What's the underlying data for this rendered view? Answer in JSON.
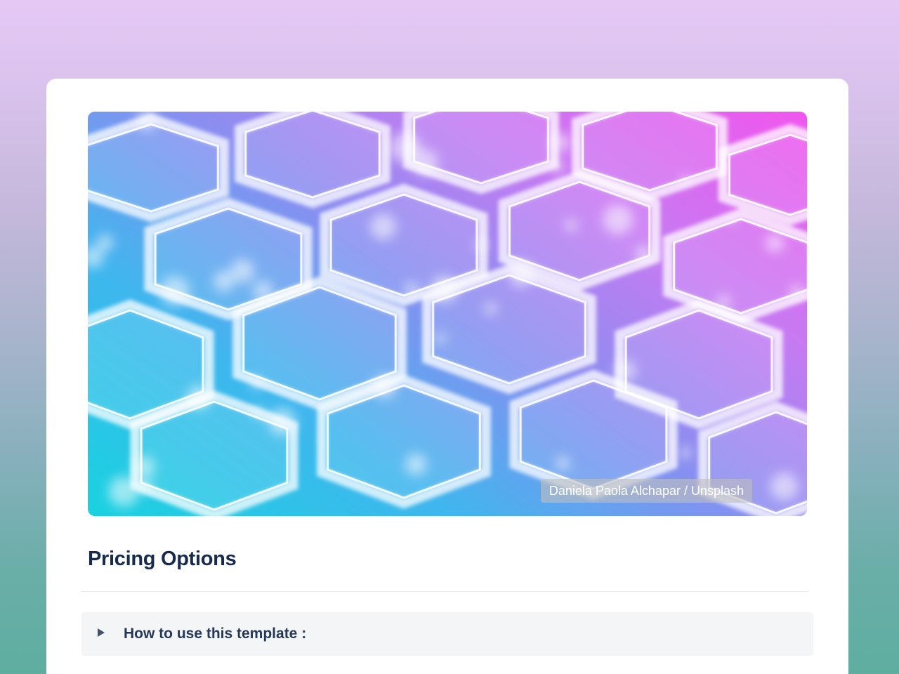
{
  "cover": {
    "attribution": "Daniela Paola Alchapar / Unsplash"
  },
  "page": {
    "title": "Pricing Options"
  },
  "expand": {
    "label": "How to use this template :",
    "icon": "triangle-right-icon"
  }
}
